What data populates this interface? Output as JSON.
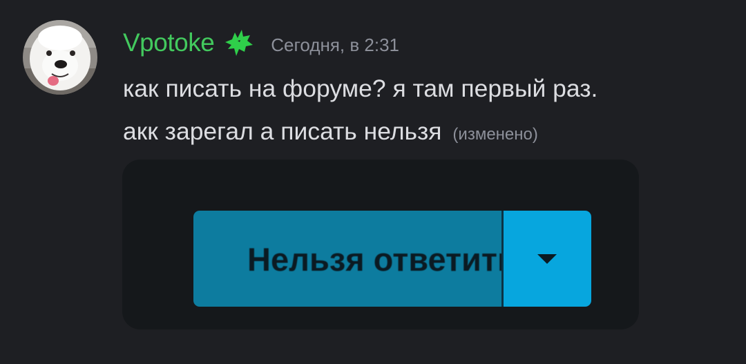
{
  "message": {
    "author": {
      "username": "Vpotoke",
      "username_color": "#43c95e",
      "avatar_icon": "samoyed-dog-avatar",
      "role_icon": "green-wolf-icon"
    },
    "timestamp": "Сегодня, в 2:31",
    "content": {
      "line1": "как писать на форуме? я там первый раз.",
      "line2": "акк зарегал а писать нельзя",
      "edited_label": "(изменено)"
    },
    "attachment": {
      "reply_button_label": "Нельзя ответить",
      "dropdown_icon": "caret-down-icon",
      "reply_button_color": "#0d7c9f",
      "dropdown_color": "#07a6de"
    }
  }
}
